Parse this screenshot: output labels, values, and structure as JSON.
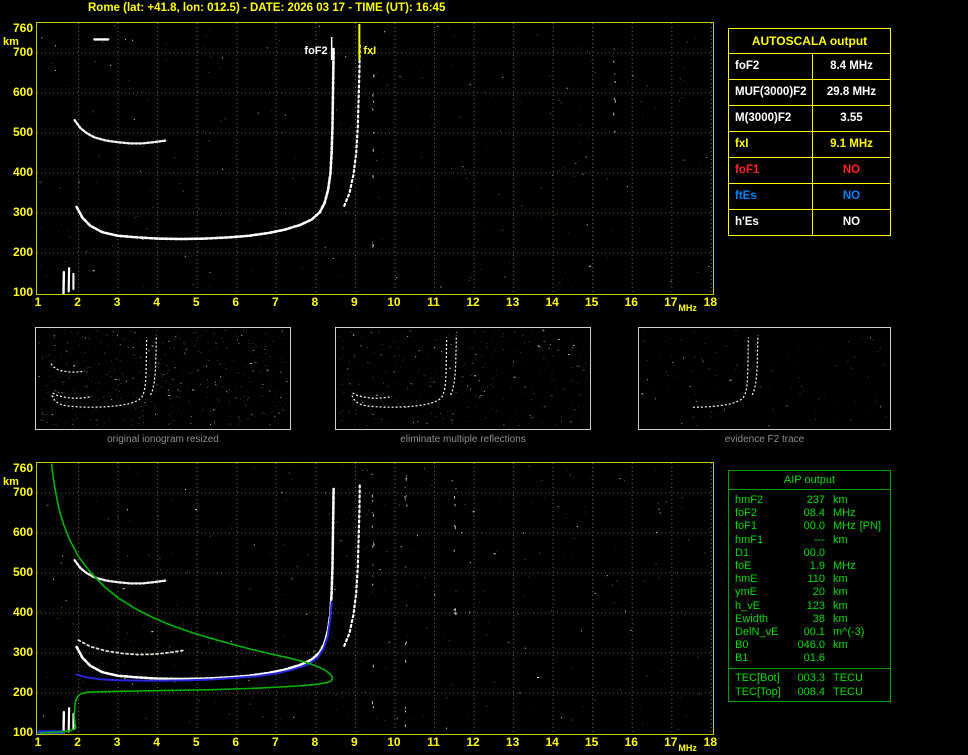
{
  "title": "Rome (lat: +41.8, lon: 012.5) - DATE: 2026 03 17 - TIME (UT): 16:45",
  "colors": {
    "background": "#000000",
    "yellow": "#ffff00",
    "plot_border": "#c8c800",
    "grid": "#6a6a22",
    "white": "#ffffff",
    "red": "#ff2222",
    "blue": "#0084ff",
    "trace_blue": "#2626dd",
    "green": "#00b400",
    "aip_text": "#00dc00",
    "caption_gray": "#8f8f8f"
  },
  "autoscala": {
    "title": "AUTOSCALA output",
    "rows": [
      {
        "param": "foF2",
        "value": "8.4 MHz",
        "color": "#ffffff"
      },
      {
        "param": "MUF(3000)F2",
        "value": "29.8 MHz",
        "color": "#ffffff"
      },
      {
        "param": "M(3000)F2",
        "value": "3.55",
        "color": "#ffffff"
      },
      {
        "param": "fxI",
        "value": "9.1 MHz",
        "color": "#ffff00"
      },
      {
        "param": "foF1",
        "value": "NO",
        "color": "#ff2222"
      },
      {
        "param": "ftEs",
        "value": "NO",
        "color": "#0084ff"
      },
      {
        "param": "h'Es",
        "value": "NO",
        "color": "#ffffff"
      }
    ]
  },
  "aip": {
    "title": "AIP output",
    "rows": [
      {
        "param": "hmF2",
        "value": "237",
        "unit": "km"
      },
      {
        "param": "foF2",
        "value": "08.4",
        "unit": "MHz"
      },
      {
        "param": "foF1",
        "value": "00.0",
        "unit": "MHz",
        "note": "[PN]"
      },
      {
        "param": "hmF1",
        "value": "---",
        "unit": "km"
      },
      {
        "param": "D1",
        "value": "00.0",
        "unit": ""
      },
      {
        "param": "foE",
        "value": "1.9",
        "unit": "MHz"
      },
      {
        "param": "hmE",
        "value": "110",
        "unit": "km"
      },
      {
        "param": "ymE",
        "value": "20",
        "unit": "km"
      },
      {
        "param": "h_vE",
        "value": "123",
        "unit": "km"
      },
      {
        "param": "Ewidth",
        "value": "38",
        "unit": "km"
      },
      {
        "param": "DelN_vE",
        "value": "00.1",
        "unit": "m^(-3)"
      },
      {
        "param": "B0",
        "value": "046.0",
        "unit": "km"
      },
      {
        "param": "B1",
        "value": "01.6",
        "unit": ""
      }
    ],
    "tec_rows": [
      {
        "param": "TEC[Bot]",
        "value": "003.3",
        "unit": "TECU"
      },
      {
        "param": "TEC[Top]",
        "value": "008.4",
        "unit": "TECU"
      }
    ]
  },
  "thumbnails": [
    {
      "caption": "original ionogram resized",
      "seed": 11,
      "noise": 520,
      "series": [
        {
          "name": "f2"
        },
        {
          "name": "xmode"
        },
        {
          "name": "hop2"
        },
        {
          "name": "multiple2"
        }
      ]
    },
    {
      "caption": "eliminate multiple reflections",
      "seed": 23,
      "noise": 300,
      "series": [
        {
          "name": "f2"
        },
        {
          "name": "xmode"
        },
        {
          "name": "multiple2"
        }
      ]
    },
    {
      "caption": "evidence F2 trace",
      "seed": 37,
      "noise": 110,
      "series": [
        {
          "name": "f2",
          "fmin": 4.2
        },
        {
          "name": "xmode"
        }
      ]
    }
  ],
  "chart_data": [
    {
      "name": "main-ionogram",
      "svg_id": "svg-top",
      "type": "scatter",
      "xlabel": "MHz",
      "ylabel": "km",
      "xlim": [
        1,
        18
      ],
      "ylim": [
        100,
        775
      ],
      "x_ticks": [
        1,
        2,
        3,
        4,
        5,
        6,
        7,
        8,
        9,
        10,
        11,
        12,
        13,
        14,
        15,
        16,
        17,
        18
      ],
      "y_ticks": [
        760,
        700,
        600,
        500,
        400,
        300,
        200,
        100
      ],
      "grid": true,
      "seed": 5,
      "noise": 260,
      "columns": [
        {
          "f": 9.45,
          "n": 12,
          "h0": 160,
          "h1": 735
        },
        {
          "f": 15.55,
          "n": 8,
          "h0": 430,
          "h1": 740
        }
      ],
      "markers": [
        {
          "label": "foF2",
          "f": 8.4,
          "color": "#ffffff",
          "anchor": "end"
        },
        {
          "label": "fxI",
          "f": 9.1,
          "color": "#ffff00",
          "anchor": "start"
        }
      ],
      "traces": {
        "f2": {
          "color": "#ffffff",
          "width": 2.6,
          "dash": "3 2",
          "points": [
            [
              1.95,
              315
            ],
            [
              2.1,
              288
            ],
            [
              2.3,
              268
            ],
            [
              2.6,
              252
            ],
            [
              3,
              243
            ],
            [
              3.5,
              239
            ],
            [
              4,
              236
            ],
            [
              4.6,
              235
            ],
            [
              5.2,
              236
            ],
            [
              5.8,
              239
            ],
            [
              6.3,
              243
            ],
            [
              6.8,
              250
            ],
            [
              7.2,
              258
            ],
            [
              7.6,
              270
            ],
            [
              7.9,
              284
            ],
            [
              8.1,
              302
            ],
            [
              8.22,
              325
            ],
            [
              8.31,
              358
            ],
            [
              8.37,
              400
            ],
            [
              8.4,
              455
            ],
            [
              8.42,
              520
            ],
            [
              8.43,
              590
            ],
            [
              8.44,
              655
            ],
            [
              8.45,
              710
            ]
          ]
        },
        "xmode": {
          "color": "#ffffff",
          "width": 2.2,
          "dash": "2 3",
          "points": [
            [
              8.72,
              318
            ],
            [
              8.85,
              350
            ],
            [
              8.95,
              395
            ],
            [
              9.02,
              450
            ],
            [
              9.06,
              515
            ],
            [
              9.08,
              585
            ],
            [
              9.1,
              655
            ],
            [
              9.11,
              725
            ]
          ]
        },
        "hop2": {
          "color": "#f0f0f0",
          "width": 2.4,
          "dash": "2 2",
          "points": [
            [
              1.9,
              532
            ],
            [
              2.05,
              512
            ],
            [
              2.2,
              500
            ],
            [
              2.4,
              489
            ],
            [
              2.7,
              481
            ],
            [
              3,
              477
            ],
            [
              3.3,
              474
            ],
            [
              3.6,
              474
            ],
            [
              3.9,
              477
            ],
            [
              4.2,
              481
            ]
          ]
        },
        "dash_top": {
          "color": "#ffffff",
          "width": 2.4,
          "points": [
            [
              2.4,
              734
            ],
            [
              2.75,
              734
            ]
          ]
        },
        "art1": {
          "color": "#ffffff",
          "width": 2.4,
          "points": [
            [
              1.62,
              100
            ],
            [
              1.63,
              152
            ]
          ]
        },
        "art2": {
          "color": "#ffffff",
          "width": 2.2,
          "points": [
            [
              1.75,
              104
            ],
            [
              1.76,
              162
            ]
          ]
        },
        "art3": {
          "color": "#ffffff",
          "width": 2.0,
          "points": [
            [
              1.87,
              110
            ],
            [
              1.87,
              148
            ]
          ]
        }
      }
    },
    {
      "name": "profile-ionogram",
      "svg_id": "svg-bot",
      "type": "scatter",
      "xlabel": "MHz",
      "ylabel": "km",
      "xlim": [
        1,
        18
      ],
      "ylim": [
        100,
        775
      ],
      "x_ticks": [
        1,
        2,
        3,
        4,
        5,
        6,
        7,
        8,
        9,
        10,
        11,
        12,
        13,
        14,
        15,
        16,
        17,
        18
      ],
      "y_ticks": [
        760,
        700,
        600,
        500,
        400,
        300,
        200,
        100
      ],
      "grid": true,
      "seed": 9,
      "noise": 320,
      "columns": [
        {
          "f": 9.45,
          "n": 14,
          "h0": 130,
          "h1": 740
        },
        {
          "f": 10.28,
          "n": 16,
          "h0": 110,
          "h1": 745
        },
        {
          "f": 11.52,
          "n": 10,
          "h0": 380,
          "h1": 745
        }
      ],
      "markers": [],
      "traces": {
        "f2": {
          "color": "#ffffff",
          "width": 2.6,
          "dash": "3 2",
          "points": [
            [
              1.95,
              315
            ],
            [
              2.1,
              288
            ],
            [
              2.3,
              268
            ],
            [
              2.6,
              252
            ],
            [
              3,
              243
            ],
            [
              3.5,
              239
            ],
            [
              4,
              236
            ],
            [
              4.6,
              235
            ],
            [
              5.2,
              236
            ],
            [
              5.8,
              239
            ],
            [
              6.3,
              243
            ],
            [
              6.8,
              250
            ],
            [
              7.2,
              258
            ],
            [
              7.6,
              270
            ],
            [
              7.9,
              284
            ],
            [
              8.1,
              302
            ],
            [
              8.22,
              325
            ],
            [
              8.31,
              358
            ],
            [
              8.37,
              400
            ],
            [
              8.4,
              455
            ],
            [
              8.42,
              520
            ],
            [
              8.43,
              590
            ],
            [
              8.44,
              655
            ],
            [
              8.45,
              710
            ]
          ]
        },
        "xmode": {
          "color": "#ffffff",
          "width": 2.2,
          "dash": "2 3",
          "points": [
            [
              8.72,
              318
            ],
            [
              8.85,
              350
            ],
            [
              8.95,
              395
            ],
            [
              9.02,
              450
            ],
            [
              9.06,
              515
            ],
            [
              9.08,
              585
            ],
            [
              9.1,
              655
            ],
            [
              9.11,
              725
            ]
          ]
        },
        "hop2": {
          "color": "#f0f0f0",
          "width": 2.4,
          "dash": "2 2",
          "points": [
            [
              1.9,
              532
            ],
            [
              2.05,
              512
            ],
            [
              2.2,
              500
            ],
            [
              2.4,
              489
            ],
            [
              2.7,
              481
            ],
            [
              3,
              477
            ],
            [
              3.3,
              474
            ],
            [
              3.6,
              474
            ],
            [
              3.9,
              477
            ],
            [
              4.2,
              481
            ]
          ]
        },
        "multiple2": {
          "color": "#e0e0e0",
          "width": 1.8,
          "dash": "2 3",
          "points": [
            [
              2,
              332
            ],
            [
              2.3,
              316
            ],
            [
              2.7,
              305
            ],
            [
              3.1,
              299
            ],
            [
              3.5,
              296
            ],
            [
              3.9,
              297
            ],
            [
              4.3,
              301
            ],
            [
              4.7,
              307
            ]
          ]
        },
        "art1": {
          "color": "#ffffff",
          "width": 2.4,
          "points": [
            [
              1.62,
              100
            ],
            [
              1.63,
              152
            ]
          ]
        },
        "art2": {
          "color": "#ffffff",
          "width": 2.2,
          "points": [
            [
              1.75,
              104
            ],
            [
              1.76,
              162
            ]
          ]
        },
        "art3": {
          "color": "#ffffff",
          "width": 2.0,
          "points": [
            [
              1.87,
              110
            ],
            [
              1.87,
              148
            ]
          ]
        },
        "blue": {
          "color": "#2626dd",
          "width": 2.0,
          "points": [
            [
              1.95,
              246
            ],
            [
              2.2,
              239
            ],
            [
              2.6,
              234
            ],
            [
              3,
              232
            ],
            [
              3.6,
              231
            ],
            [
              4.2,
              231
            ],
            [
              4.8,
              232
            ],
            [
              5.4,
              234
            ],
            [
              6,
              238
            ],
            [
              6.5,
              242
            ],
            [
              7,
              249
            ],
            [
              7.4,
              258
            ],
            [
              7.8,
              271
            ],
            [
              8.05,
              289
            ],
            [
              8.2,
              312
            ],
            [
              8.3,
              342
            ],
            [
              8.36,
              382
            ],
            [
              8.4,
              428
            ]
          ]
        },
        "blue_base": {
          "color": "#2626dd",
          "width": 4.0,
          "points": [
            [
              1,
              102
            ],
            [
              1.6,
              102
            ]
          ]
        },
        "green": {
          "color": "#00b400",
          "width": 1.6,
          "points": [
            [
              1.32,
              772
            ],
            [
              1.36,
              740
            ],
            [
              1.42,
              702
            ],
            [
              1.5,
              662
            ],
            [
              1.62,
              622
            ],
            [
              1.78,
              582
            ],
            [
              2,
              541
            ],
            [
              2.3,
              502
            ],
            [
              2.65,
              466
            ],
            [
              3,
              438
            ],
            [
              3.4,
              413
            ],
            [
              3.85,
              390
            ],
            [
              4.3,
              371
            ],
            [
              4.8,
              353
            ],
            [
              5.3,
              338
            ],
            [
              5.8,
              324
            ],
            [
              6.3,
              311
            ],
            [
              6.8,
              299
            ],
            [
              7.3,
              288
            ],
            [
              7.7,
              278
            ],
            [
              8,
              268
            ],
            [
              8.2,
              259
            ],
            [
              8.33,
              250
            ],
            [
              8.4,
              243
            ],
            [
              8.42,
              237
            ],
            [
              8.39,
              230
            ],
            [
              8.28,
              226
            ],
            [
              8.05,
              222
            ],
            [
              7.6,
              218
            ],
            [
              7.1,
              215
            ],
            [
              6.5,
              212
            ],
            [
              5.9,
              210
            ],
            [
              5.3,
              208
            ],
            [
              4.7,
              207
            ],
            [
              4.1,
              206
            ],
            [
              3.5,
              205
            ],
            [
              2.95,
              204
            ],
            [
              2.55,
              203
            ],
            [
              2.25,
              202
            ],
            [
              2.08,
              199
            ],
            [
              1.99,
              193
            ],
            [
              1.94,
              184
            ],
            [
              1.91,
              172
            ],
            [
              1.9,
              158
            ],
            [
              1.89,
              144
            ],
            [
              1.9,
              131
            ],
            [
              1.91,
              122
            ],
            [
              1.93,
              115
            ],
            [
              1.91,
              110
            ],
            [
              1.83,
              107
            ],
            [
              1.68,
              104
            ],
            [
              1.45,
              102
            ],
            [
              1.2,
              101
            ],
            [
              1.03,
              100
            ]
          ]
        }
      }
    }
  ]
}
